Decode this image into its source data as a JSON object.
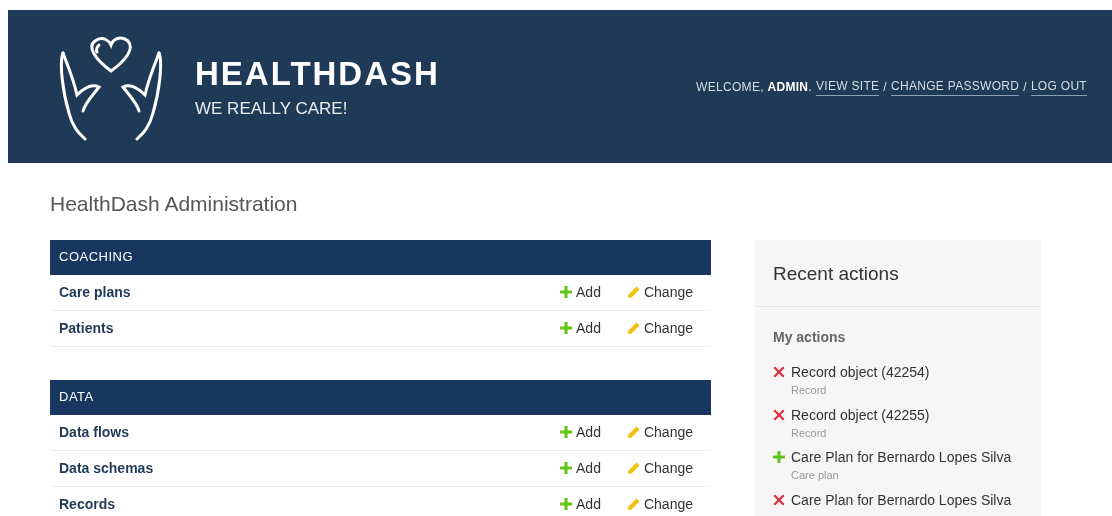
{
  "header": {
    "brand": "HEALTHDASH",
    "tagline": "WE REALLY CARE!",
    "welcome": "WELCOME, **ADMIN**.",
    "links": [
      "VIEW SITE",
      "CHANGE PASSWORD",
      "LOG OUT"
    ],
    "separator": "/"
  },
  "page_title": "HealthDash Administration",
  "modules": [
    {
      "caption": "COACHING",
      "rows": [
        {
          "name": "Care plans",
          "add": "Add",
          "change": "Change"
        },
        {
          "name": "Patients",
          "add": "Add",
          "change": "Change"
        }
      ]
    },
    {
      "caption": "DATA",
      "rows": [
        {
          "name": "Data flows",
          "add": "Add",
          "change": "Change"
        },
        {
          "name": "Data schemas",
          "add": "Add",
          "change": "Change"
        },
        {
          "name": "Records",
          "add": "Add",
          "change": "Change"
        }
      ]
    }
  ],
  "recent_actions": {
    "title": "Recent actions",
    "subtitle": "My actions",
    "items": [
      {
        "kind": "deletion",
        "label": "Record object (42254)",
        "type": "Record"
      },
      {
        "kind": "deletion",
        "label": "Record object (42255)",
        "type": "Record"
      },
      {
        "kind": "addition",
        "label": "Care Plan for Bernardo Lopes Silva",
        "type": "Care plan"
      },
      {
        "kind": "deletion",
        "label": "Care Plan for Bernardo Lopes Silva"
      }
    ]
  }
}
